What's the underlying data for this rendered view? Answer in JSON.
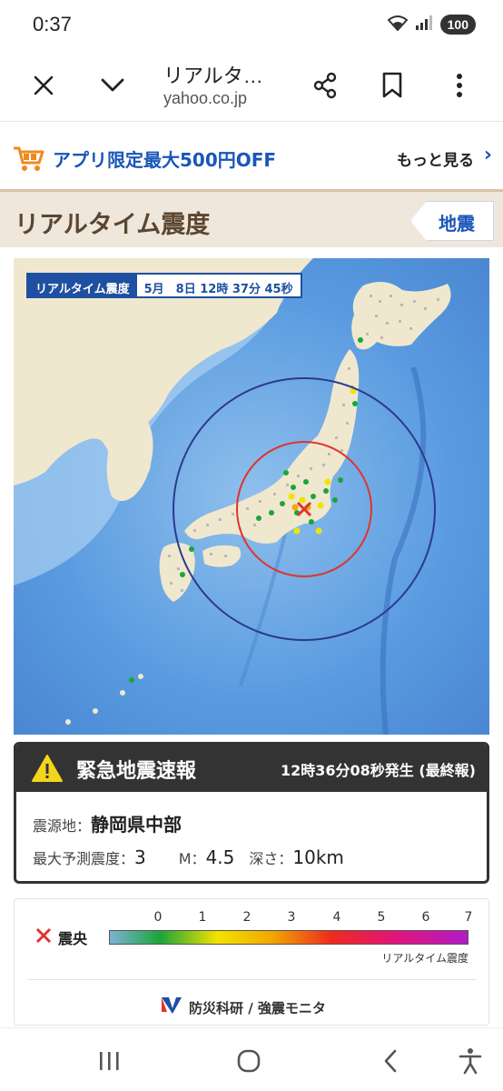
{
  "status_bar": {
    "time": "0:37",
    "battery": "100",
    "icons": [
      "wifi-icon",
      "signal-icon"
    ]
  },
  "browser": {
    "title": "リアルタ…",
    "domain": "yahoo.co.jp",
    "icons": [
      "close-icon",
      "chevron-down-icon",
      "share-icon",
      "bookmark-icon",
      "more-vert-icon"
    ]
  },
  "promo": {
    "text": "アプリ限定最大500円OFF",
    "more": "もっと見る",
    "icon": "cart-icon"
  },
  "header": {
    "title": "リアルタイム震度",
    "tag": "地震"
  },
  "map": {
    "label_title": "リアルタイム震度",
    "label_time": "5月　8日 12時 37分 45秒",
    "colors": {
      "sea": "#4b8fd6",
      "land": "#f1ead2",
      "inner_circle": "#e0332d",
      "outer_circle": "#2b3a8f"
    }
  },
  "eew": {
    "title": "緊急地震速報",
    "time": "12時36分08秒発生 (最終報)",
    "epicenter_label": "震源地：",
    "epicenter": "静岡県中部",
    "max_intensity_label": "最大予測震度：",
    "max_intensity": "3",
    "magnitude_label": "M：",
    "magnitude": "4.5",
    "depth_label": "深さ：",
    "depth": "10km"
  },
  "legend": {
    "epicenter_label": "震央",
    "ticks": [
      "0",
      "1",
      "2",
      "3",
      "4",
      "5",
      "6",
      "7"
    ],
    "caption": "リアルタイム震度",
    "source": "防災科研 / 強震モニタ",
    "logo_text": "NIED"
  },
  "nav": {
    "icons": [
      "recents-icon",
      "home-icon",
      "back-icon",
      "accessibility-icon"
    ]
  }
}
